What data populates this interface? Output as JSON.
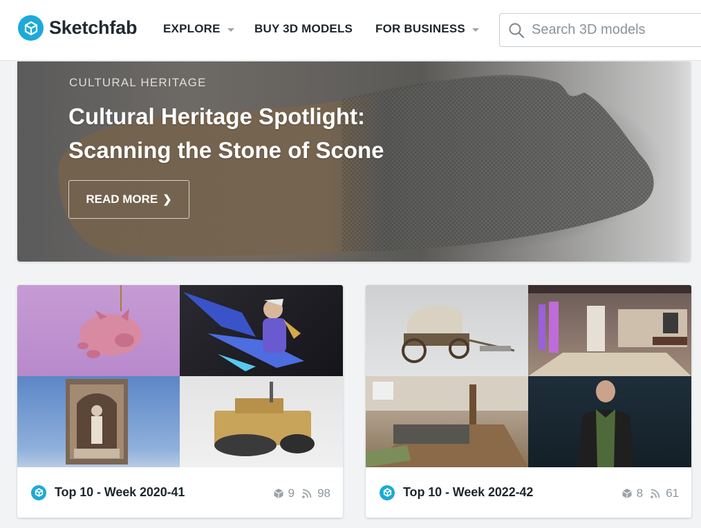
{
  "header": {
    "brand": "Sketchfab",
    "nav": [
      {
        "label": "EXPLORE",
        "has_dropdown": true
      },
      {
        "label": "BUY 3D MODELS",
        "has_dropdown": false
      },
      {
        "label": "FOR BUSINESS",
        "has_dropdown": true
      }
    ],
    "search": {
      "placeholder": "Search 3D models",
      "value": ""
    }
  },
  "hero": {
    "category": "CULTURAL HERITAGE",
    "title": "Cultural Heritage Spotlight: Scanning the Stone of Scone",
    "button_label": "READ MORE"
  },
  "collections": [
    {
      "title": "Top 10 - Week 2020-41",
      "models": "9",
      "followers": "98"
    },
    {
      "title": "Top 10 - Week 2022-42",
      "models": "8",
      "followers": "61"
    }
  ],
  "colors": {
    "accent": "#1caad9"
  }
}
